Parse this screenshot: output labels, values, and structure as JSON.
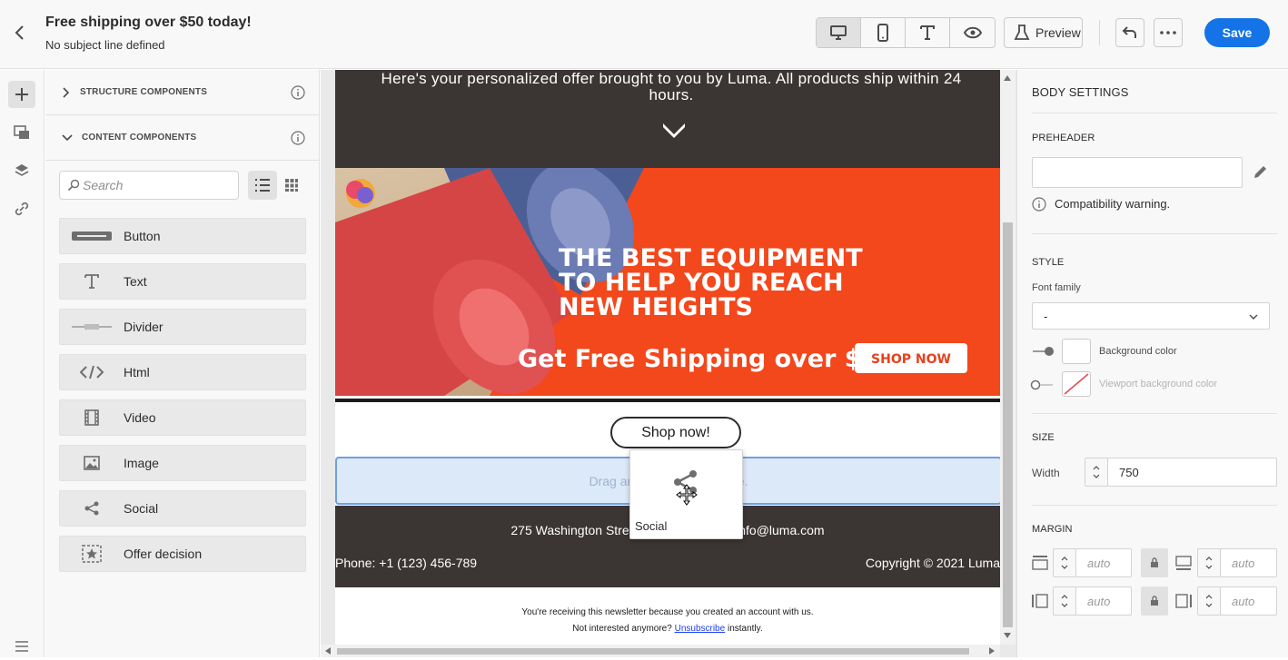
{
  "header": {
    "title": "Free shipping over $50 today!",
    "subtitle": "No subject line defined",
    "preview_label": "Preview",
    "save_label": "Save"
  },
  "left_panel": {
    "structure_label": "STRUCTURE COMPONENTS",
    "content_label": "CONTENT COMPONENTS",
    "search_placeholder": "Search",
    "components": [
      {
        "label": "Button",
        "icon": "button-icon"
      },
      {
        "label": "Text",
        "icon": "text-icon"
      },
      {
        "label": "Divider",
        "icon": "divider-icon"
      },
      {
        "label": "Html",
        "icon": "code-icon"
      },
      {
        "label": "Video",
        "icon": "video-icon"
      },
      {
        "label": "Image",
        "icon": "image-icon"
      },
      {
        "label": "Social",
        "icon": "share-icon"
      },
      {
        "label": "Offer decision",
        "icon": "offer-decision-icon"
      }
    ]
  },
  "email": {
    "personalized_text": "Here's your personalized offer brought to you by Luma. All products ship within 24 hours.",
    "hero_headline": [
      "THE BEST EQUIPMENT",
      "TO HELP YOU REACH",
      "NEW HEIGHTS"
    ],
    "hero_shipping": "Get Free Shipping over $50",
    "hero_cta": "SHOP NOW",
    "shop_button": "Shop now!",
    "drop_zone": "Drag and drop content here.",
    "footer_address": "275 Washington Street, Florida 02458 - info@luma.com",
    "footer_phone": "Phone: +1 (123) 456-789",
    "footer_copyright": "Copyright © 2021 Luma",
    "newsletter_note": "You're receiving this newsletter because you created an account with us.",
    "unsub_prefix": "Not interested anymore?",
    "unsub_link": "Unsubscribe",
    "unsub_suffix": "instantly."
  },
  "drag_ghost": {
    "label": "Social"
  },
  "right_panel": {
    "title": "BODY SETTINGS",
    "preheader_label": "PREHEADER",
    "preheader_value": "",
    "compat_warning": "Compatibility warning.",
    "style_label": "STYLE",
    "font_family_label": "Font family",
    "font_family_value": "-",
    "bg_color_label": "Background color",
    "viewport_bg_label": "Viewport background color",
    "size_label": "SIZE",
    "width_label": "Width",
    "width_value": "750",
    "margin_label": "MARGIN",
    "margin_values": [
      "auto",
      "auto",
      "auto",
      "auto"
    ]
  },
  "colors": {
    "accent": "#1473e6",
    "email_dark": "#3b3533",
    "hero_orange": "#f3471c"
  }
}
